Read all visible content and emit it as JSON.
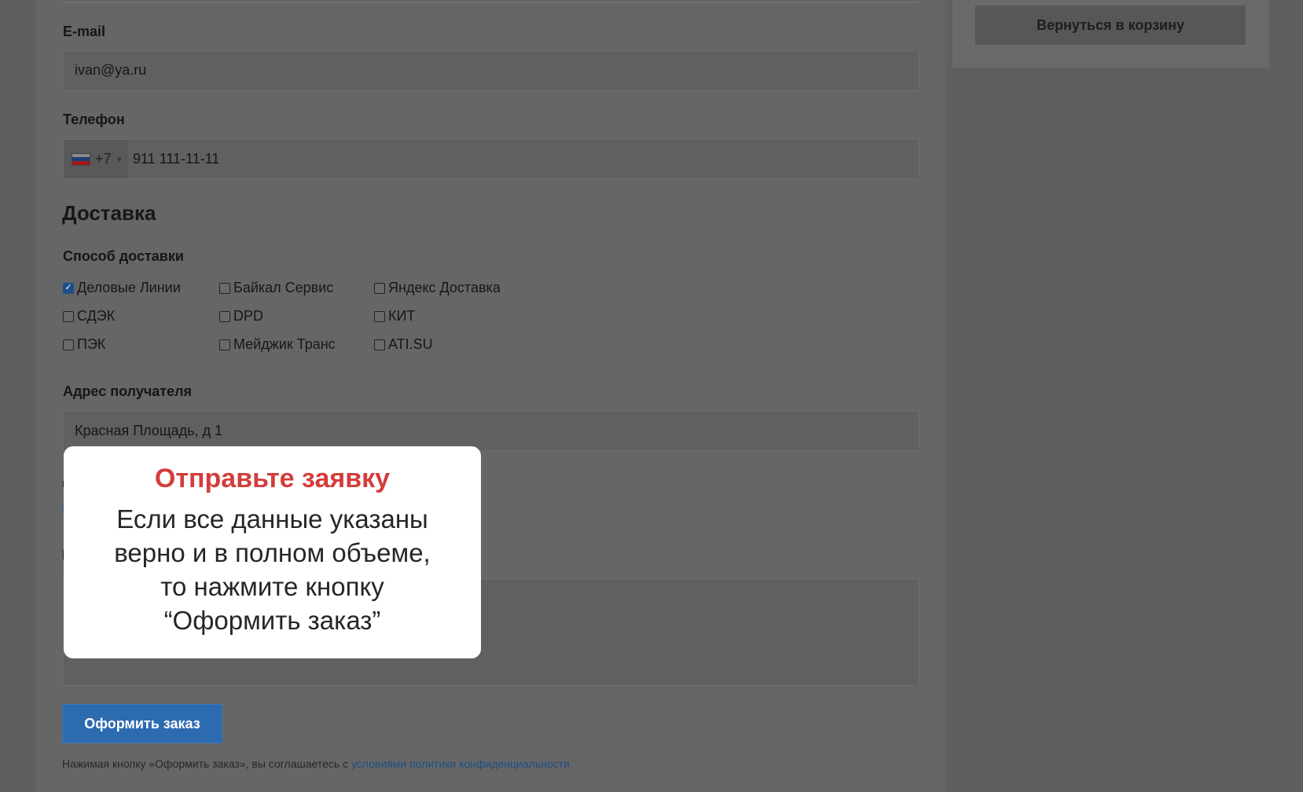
{
  "form": {
    "email_label": "E-mail",
    "email_value": "ivan@ya.ru",
    "phone_label": "Телефон",
    "phone_code": "+7",
    "phone_value": "911 111-11-11",
    "delivery_title": "Доставка",
    "delivery_method_label": "Способ доставки",
    "delivery_options": [
      {
        "label": "Деловые Линии",
        "checked": true
      },
      {
        "label": "Байкал Сервис",
        "checked": false
      },
      {
        "label": "Яндекс Доставка",
        "checked": false
      },
      {
        "label": "СДЭК",
        "checked": false
      },
      {
        "label": "DPD",
        "checked": false
      },
      {
        "label": "КИТ",
        "checked": false
      },
      {
        "label": "ПЭК",
        "checked": false
      },
      {
        "label": "Мейджик Транс",
        "checked": false
      },
      {
        "label": "ATI.SU",
        "checked": false
      }
    ],
    "address_label": "Адрес получателя",
    "address_value": "Красная Площадь, д 1",
    "submit_label": "Оформить заказ",
    "agree_text": "Нажимая кнопку «Оформить заказ», вы соглашаетесь с",
    "agree_link": "условиями политики конфиденциальности"
  },
  "sidebar": {
    "back_label": "Вернуться в корзину"
  },
  "tooltip": {
    "title": "Отправьте заявку",
    "lines": [
      "Если все данные указаны",
      "верно и в полном объеме,",
      "то нажмите кнопку",
      "“Оформить заказ”"
    ]
  },
  "colors": {
    "overlay": "#5f5f5f",
    "accent": "#2d6bb0",
    "tooltip_title": "#d43c3c"
  }
}
